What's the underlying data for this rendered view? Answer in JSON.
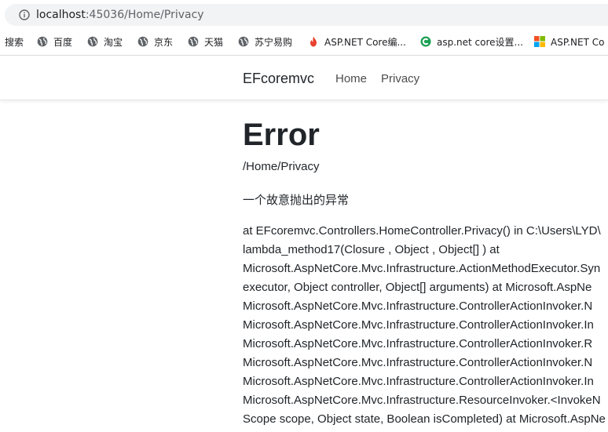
{
  "browser": {
    "url_host": "localhost",
    "url_port_path": ":45036/Home/Privacy"
  },
  "bookmarks": [
    {
      "label": "搜索",
      "icon": "none"
    },
    {
      "label": "百度",
      "icon": "globe-icon"
    },
    {
      "label": "淘宝",
      "icon": "globe-icon"
    },
    {
      "label": "京东",
      "icon": "globe-icon"
    },
    {
      "label": "天猫",
      "icon": "globe-icon"
    },
    {
      "label": "苏宁易购",
      "icon": "globe-icon"
    },
    {
      "label": "ASP.NET Core编...",
      "icon": "flame-icon"
    },
    {
      "label": "asp.net core设置...",
      "icon": "green-c-icon"
    },
    {
      "label": "ASP.NET Co",
      "icon": "microsoft-icon"
    }
  ],
  "nav": {
    "brand": "EFcoremvc",
    "links": [
      "Home",
      "Privacy"
    ]
  },
  "error": {
    "title": "Error",
    "path": "/Home/Privacy",
    "message": "一个故意抛出的异常",
    "stack_lines": [
      "at EFcoremvc.Controllers.HomeController.Privacy() in C:\\Users\\LYD\\",
      "lambda_method17(Closure , Object , Object[] ) at",
      "Microsoft.AspNetCore.Mvc.Infrastructure.ActionMethodExecutor.Syn",
      "executor, Object controller, Object[] arguments) at Microsoft.AspNe",
      "Microsoft.AspNetCore.Mvc.Infrastructure.ControllerActionInvoker.N",
      "Microsoft.AspNetCore.Mvc.Infrastructure.ControllerActionInvoker.In",
      "Microsoft.AspNetCore.Mvc.Infrastructure.ControllerActionInvoker.R",
      "Microsoft.AspNetCore.Mvc.Infrastructure.ControllerActionInvoker.N",
      "Microsoft.AspNetCore.Mvc.Infrastructure.ControllerActionInvoker.In",
      "Microsoft.AspNetCore.Mvc.Infrastructure.ResourceInvoker.<InvokeN",
      "Scope scope, Object state, Boolean isCompleted) at Microsoft.AspNe"
    ]
  },
  "colors": {
    "accent_flame": "#e8412e",
    "accent_green": "#1a9f52"
  }
}
